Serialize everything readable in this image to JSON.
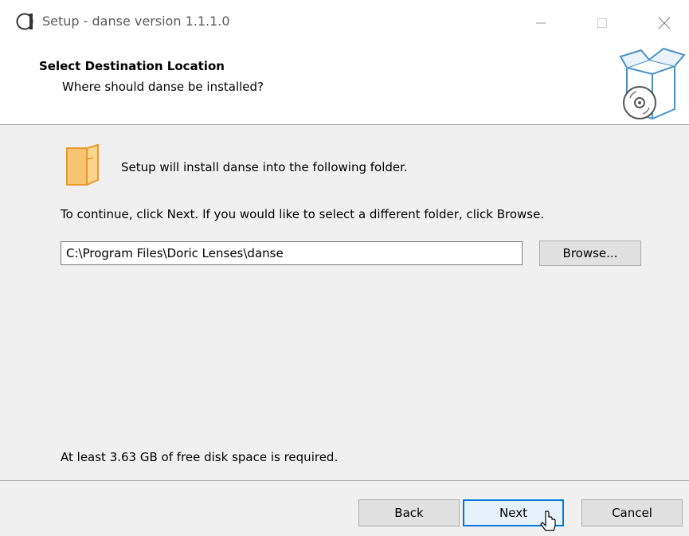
{
  "window": {
    "title": "Setup - danse version 1.1.1.0",
    "controls": {
      "minimize": "minimize-icon",
      "maximize": "maximize-icon",
      "close": "close-icon"
    }
  },
  "header": {
    "title": "Select Destination Location",
    "subtitle": "Where should danse be installed?"
  },
  "content": {
    "intro": "Setup will install danse into the following folder.",
    "instructions": "To continue, click Next. If you would like to select a different folder, click Browse.",
    "path_value": "C:\\Program Files\\Doric Lenses\\danse",
    "browse_label": "Browse...",
    "disk_space": "At least 3.63 GB of free disk space is required."
  },
  "footer": {
    "back_label": "Back",
    "next_label": "Next",
    "cancel_label": "Cancel"
  },
  "colors": {
    "content_bg": "#f0f0f0",
    "default_button_border": "#0078d7",
    "folder_icon": "#f8c471"
  }
}
